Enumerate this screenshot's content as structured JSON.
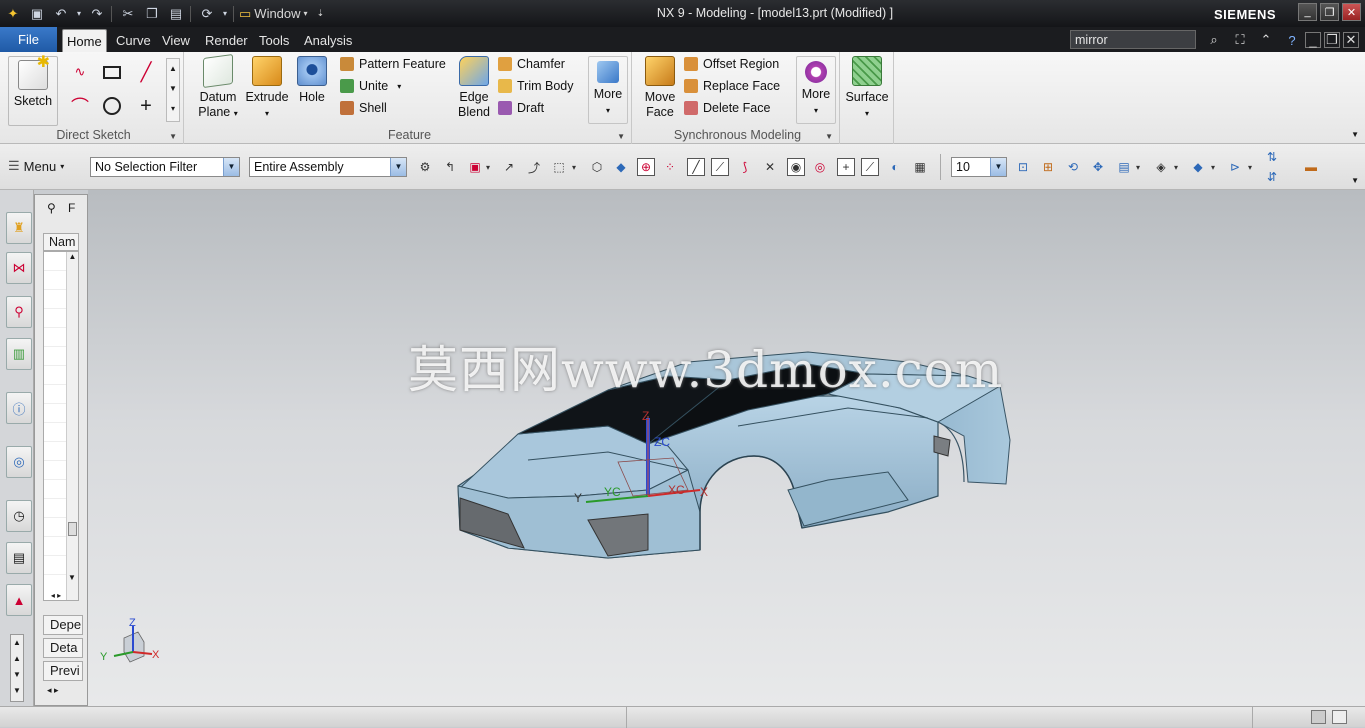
{
  "window": {
    "title": "NX 9 - Modeling - [model13.prt (Modified) ]",
    "brand": "SIEMENS",
    "window_menu_label": "Window"
  },
  "tabs": {
    "file": "File",
    "items": [
      "Home",
      "Curve",
      "View",
      "Render",
      "Tools",
      "Analysis"
    ],
    "active": "Home"
  },
  "search": {
    "value": "mirror"
  },
  "ribbon": {
    "direct_sketch": {
      "label": "Direct Sketch",
      "sketch": "Sketch"
    },
    "feature": {
      "label": "Feature",
      "datum_plane": "Datum Plane",
      "extrude": "Extrude",
      "hole": "Hole",
      "pattern_feature": "Pattern Feature",
      "unite": "Unite",
      "shell": "Shell",
      "edge_blend": "Edge Blend",
      "chamfer": "Chamfer",
      "trim_body": "Trim Body",
      "draft": "Draft",
      "more": "More"
    },
    "synchronous": {
      "label": "Synchronous Modeling",
      "move_face": "Move Face",
      "offset_region": "Offset Region",
      "replace_face": "Replace Face",
      "delete_face": "Delete Face",
      "more": "More"
    },
    "surface": {
      "label": "Surface"
    }
  },
  "selection_bar": {
    "menu": "Menu",
    "filter": "No Selection Filter",
    "scope": "Entire Assembly",
    "snap_value": "10"
  },
  "navigator": {
    "column": "Nam",
    "sections": [
      "Depe",
      "Deta",
      "Previ"
    ]
  },
  "viewport": {
    "watermark": "莫西网www.3dmox.com",
    "axes": {
      "x": "X",
      "y": "Y",
      "z": "Z"
    },
    "wcs": {
      "xc": "XC",
      "yc": "YC",
      "zc": "ZC",
      "x": "X",
      "y": "Y",
      "z": "Z"
    }
  },
  "colors": {
    "body": "#9fc1d8",
    "accent": "#2d69b8"
  }
}
